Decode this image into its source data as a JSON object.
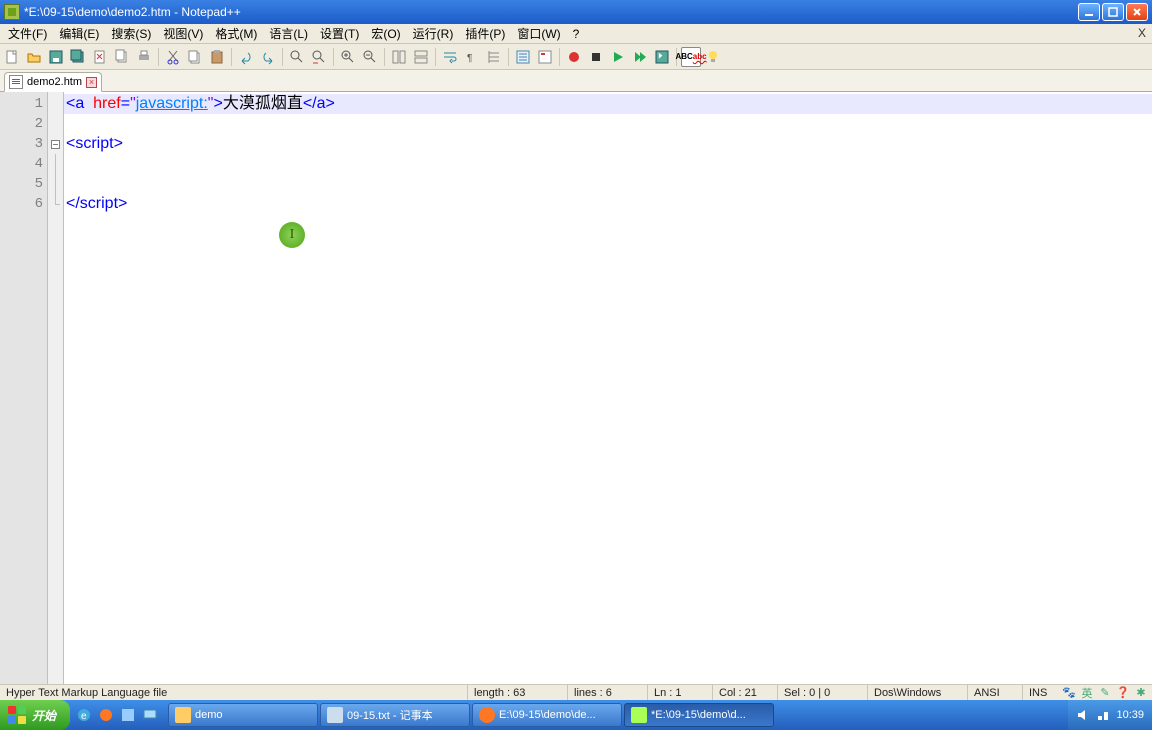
{
  "window": {
    "title": "*E:\\09-15\\demo\\demo2.htm - Notepad++"
  },
  "menu": {
    "items": [
      "文件(F)",
      "编辑(E)",
      "搜索(S)",
      "视图(V)",
      "格式(M)",
      "语言(L)",
      "设置(T)",
      "宏(O)",
      "运行(R)",
      "插件(P)",
      "窗口(W)",
      "?"
    ],
    "close_x": "X"
  },
  "tab": {
    "name": "demo2.htm",
    "close": "×"
  },
  "code": {
    "l1_tag_open": "<a",
    "l1_space": "  ",
    "l1_attr": "href",
    "l1_eq": "=",
    "l1_q1": "\"",
    "l1_url": "javascript:",
    "l1_q2": "\"",
    "l1_close": ">",
    "l1_text": "大漠孤烟直",
    "l1_end": "</a>",
    "l3": "<script>",
    "l6": "</script>"
  },
  "cursor_mark": "I",
  "status": {
    "filetype": "Hyper Text Markup Language file",
    "length": "length : 63",
    "lines": "lines : 6",
    "ln": "Ln : 1",
    "col": "Col : 21",
    "sel": "Sel : 0 | 0",
    "eol": "Dos\\Windows",
    "enc": "ANSI",
    "ins": "INS"
  },
  "tray_icons": [
    "🐾",
    "英",
    "✎",
    "❓",
    "✱"
  ],
  "taskbar": {
    "start": "开始",
    "buttons": [
      {
        "label": "demo"
      },
      {
        "label": "09-15.txt - 记事本"
      },
      {
        "label": "E:\\09-15\\demo\\de..."
      },
      {
        "label": "*E:\\09-15\\demo\\d..."
      }
    ],
    "clock": "10:39"
  }
}
